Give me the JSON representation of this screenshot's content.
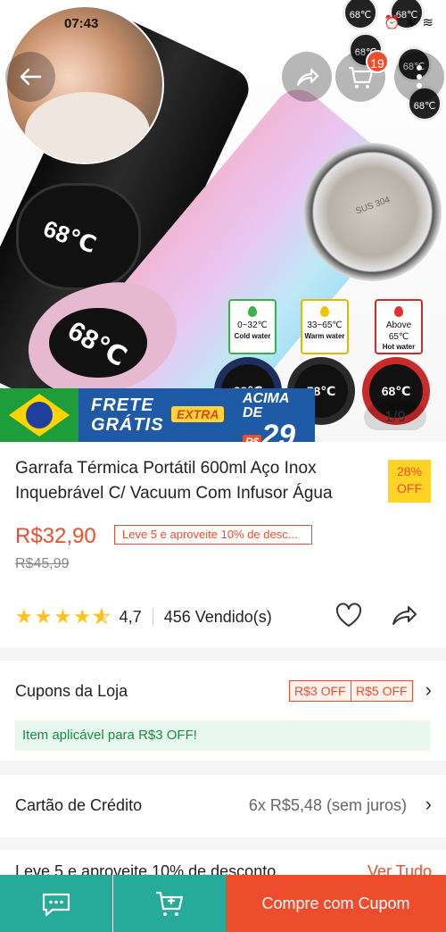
{
  "status_bar": {
    "time": "07:43"
  },
  "hero": {
    "cart_badge": "19",
    "counter": "1/9",
    "lid_black_reading": "68℃",
    "lid_pink_reading": "68℃",
    "lid_label": "SUS 304",
    "temp_cold": {
      "range": "0~32℃",
      "name": "Cold water"
    },
    "temp_warm": {
      "range": "33~65℃",
      "name": "Warm water"
    },
    "temp_hot": {
      "range": "Above 65℃",
      "name": "Hot water"
    },
    "mini_readings": [
      "28℃",
      "58℃",
      "68℃"
    ],
    "bubble_readings": [
      "68℃",
      "68℃",
      "68℃",
      "68℃",
      "68℃"
    ]
  },
  "banner": {
    "line1": "FRETE",
    "line2": "GRÁTIS",
    "extra": "EXTRA",
    "acima": "ACIMA",
    "de": "DE",
    "rs": "R$",
    "value": "29"
  },
  "product": {
    "title": "Garrafa Térmica Portátil 600ml Aço Inox Inquebrável C/ Vacuum Com Infusor Água",
    "discount_pct": "28%",
    "discount_label": "OFF",
    "price": "R$32,90",
    "promo": "Leve 5 e aproveite 10% de desc...",
    "old_price": "R$45,99",
    "rating": "4,7",
    "sold": "456 Vendido(s)"
  },
  "coupons": {
    "label": "Cupons da Loja",
    "items": [
      "R$3 OFF",
      "R$5 OFF"
    ],
    "applicable": "Item aplicável para R$3 OFF!"
  },
  "credit": {
    "label": "Cartão de Crédito",
    "value": "6x R$5,48 (sem juros)"
  },
  "more_offer": {
    "text": "Leve 5 e aproveite 10% de desconto",
    "link": "Ver Tudo"
  },
  "bottom_bar": {
    "buy_label": "Compre com Cupom"
  },
  "colors": {
    "brand": "#ee4d2d",
    "chat_bar": "#26aa99",
    "star": "#ffc21a"
  }
}
